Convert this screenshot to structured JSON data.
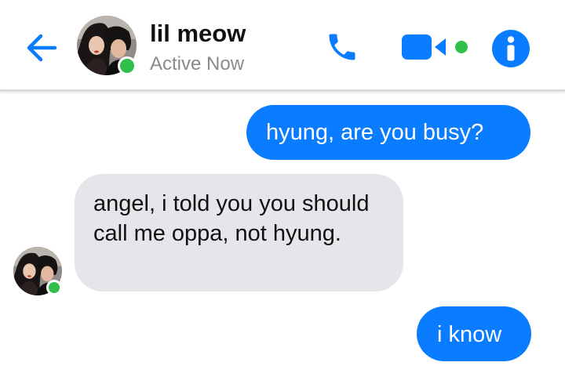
{
  "header": {
    "contact_name": "lil meow",
    "status": "Active Now",
    "back_icon": "arrow-left-icon",
    "call_icon": "phone-icon",
    "video_icon": "video-camera-icon",
    "info_icon": "info-icon"
  },
  "messages": [
    {
      "sender": "me",
      "text": "hyung, are you busy?"
    },
    {
      "sender": "contact",
      "text": "angel, i told you you should call me oppa, not hyung."
    },
    {
      "sender": "me",
      "text": "i know"
    }
  ],
  "colors": {
    "accent": "#0a7cff",
    "presence": "#2fbf4a",
    "incoming_bubble": "#e6e6ea",
    "status_text": "#8a8a8a"
  }
}
